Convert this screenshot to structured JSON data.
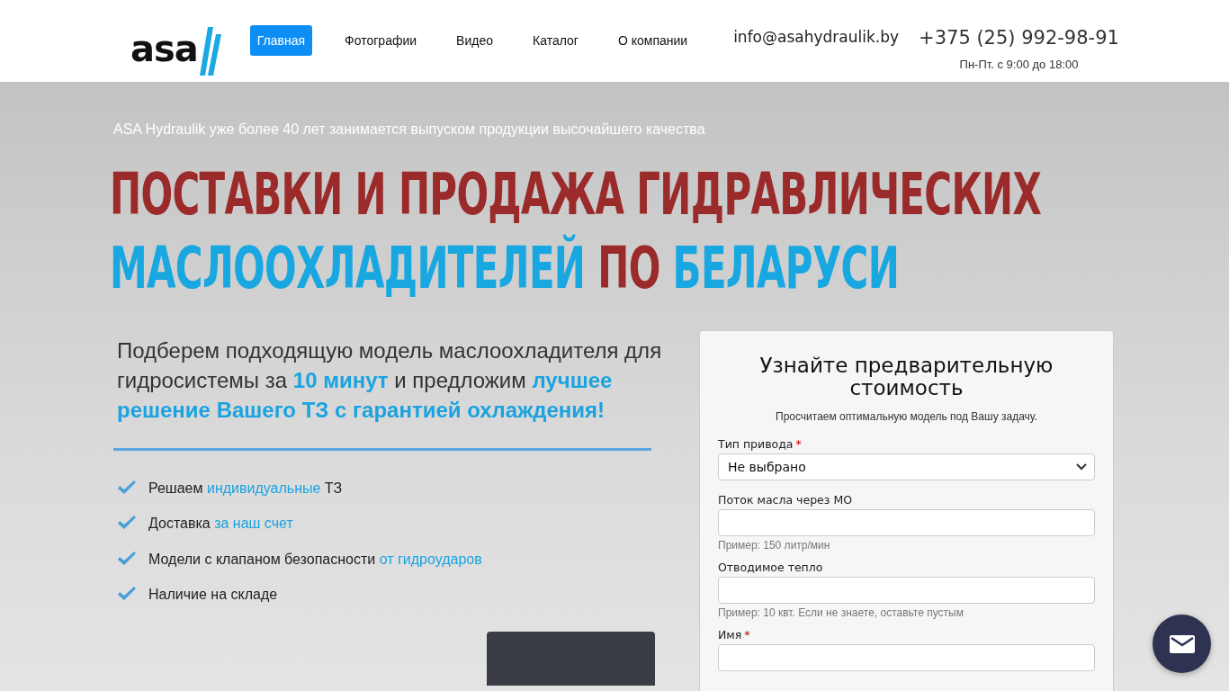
{
  "header": {
    "logo": "asa",
    "nav": [
      {
        "label": "Главная",
        "selected": true
      },
      {
        "label": "Фотографии",
        "selected": false
      },
      {
        "label": "Видео",
        "selected": false
      },
      {
        "label": "Каталог",
        "selected": false
      },
      {
        "label": "О компании",
        "selected": false
      }
    ],
    "email": "info@asahydraulik.by",
    "phone": "+375 (25) 992-98-91",
    "hours": "Пн-Пт. с 9:00 до 18:00"
  },
  "hero": {
    "intro": "ASA Hydraulik уже более 40 лет занимается выпуском продукции высочайшего качества",
    "headline": [
      [
        {
          "text": "ПОСТАВКИ И ПРОДАЖА ГИДРАВЛИЧЕСКИХ",
          "accent": false
        }
      ],
      [
        {
          "text": "МАСЛООХЛАДИТЕЛЕЙ",
          "accent": true
        },
        {
          "text": " ПО ",
          "accent": false
        },
        {
          "text": "БЕЛАРУСИ",
          "accent": true
        }
      ]
    ],
    "lead": [
      {
        "text": "Подберем подходящую модель маслоохладителя для гидросистемы за ",
        "accent": false
      },
      {
        "text": "10 минут",
        "accent": true
      },
      {
        "text": " и предложим ",
        "accent": false
      },
      {
        "text": "лучшее решение Вашего ТЗ с гарантией охлаждения!",
        "accent": true
      }
    ],
    "benefits": [
      [
        {
          "text": "Решаем ",
          "accent": false
        },
        {
          "text": "индивидуальные",
          "accent": true
        },
        {
          "text": " ТЗ",
          "accent": false
        }
      ],
      [
        {
          "text": "Доставка ",
          "accent": false
        },
        {
          "text": "за наш счет",
          "accent": true
        }
      ],
      [
        {
          "text": "Модели с клапаном безопасности ",
          "accent": false
        },
        {
          "text": "от гидроударов",
          "accent": true
        }
      ],
      [
        {
          "text": "Наличие на складе",
          "accent": false
        }
      ]
    ]
  },
  "form": {
    "title": "Узнайте предварительную стоимость",
    "subtitle": "Просчитаем оптимальную модель под Вашу задачу.",
    "fields": [
      {
        "kind": "select",
        "label": "Тип привода",
        "marker": "*",
        "value": "Не выбрано"
      },
      {
        "kind": "input",
        "label": "Поток масла через МО",
        "hint": "Пример: 150 литр/мин"
      },
      {
        "kind": "input",
        "label": "Отводимое тепло",
        "hint": "Пример: 10 квт. Если не знаете, оставьте пустым"
      },
      {
        "kind": "input",
        "label": "Имя",
        "marker": "*"
      }
    ]
  }
}
